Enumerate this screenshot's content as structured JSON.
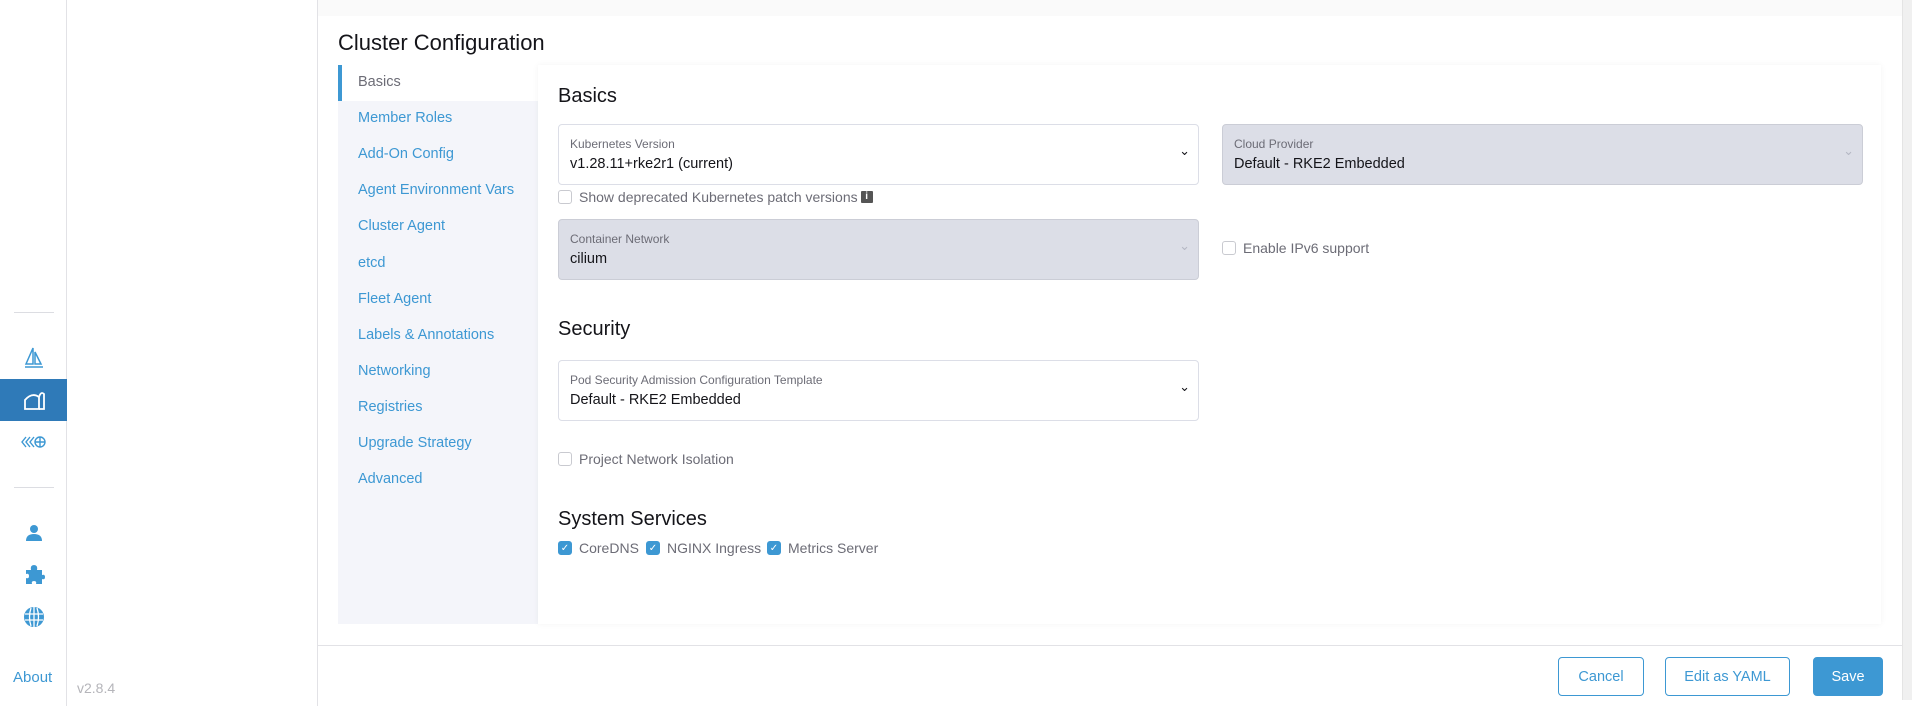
{
  "rail": {
    "items": [
      {
        "name": "fleet"
      },
      {
        "name": "cluster-management",
        "active": true
      },
      {
        "name": "continuous-delivery"
      },
      {
        "name": "users"
      },
      {
        "name": "extensions"
      },
      {
        "name": "global-settings"
      }
    ],
    "about": "About"
  },
  "version": "v2.8.4",
  "page_title": "Cluster Configuration",
  "tabs": [
    "Basics",
    "Member Roles",
    "Add-On Config",
    "Agent Environment Vars",
    "Cluster Agent",
    "etcd",
    "Fleet Agent",
    "Labels & Annotations",
    "Networking",
    "Registries",
    "Upgrade Strategy",
    "Advanced"
  ],
  "basics": {
    "heading": "Basics",
    "k8s": {
      "label": "Kubernetes Version",
      "value": "v1.28.11+rke2r1 (current)"
    },
    "cloud": {
      "label": "Cloud Provider",
      "value": "Default - RKE2 Embedded"
    },
    "deprecated": {
      "label": "Show deprecated Kubernetes patch versions",
      "checked": false
    },
    "network": {
      "label": "Container Network",
      "value": "cilium"
    },
    "ipv6": {
      "label": "Enable IPv6 support",
      "checked": false
    }
  },
  "security": {
    "heading": "Security",
    "psa": {
      "label": "Pod Security Admission Configuration Template",
      "value": "Default - RKE2 Embedded"
    },
    "isolation": {
      "label": "Project Network Isolation",
      "checked": false
    }
  },
  "services": {
    "heading": "System Services",
    "items": [
      {
        "label": "CoreDNS",
        "checked": true
      },
      {
        "label": "NGINX Ingress",
        "checked": true
      },
      {
        "label": "Metrics Server",
        "checked": true
      }
    ]
  },
  "footer": {
    "cancel": "Cancel",
    "yaml": "Edit as YAML",
    "save": "Save"
  },
  "colors": {
    "accent": "#3d98d3",
    "active_nav": "#2f7ab8"
  }
}
